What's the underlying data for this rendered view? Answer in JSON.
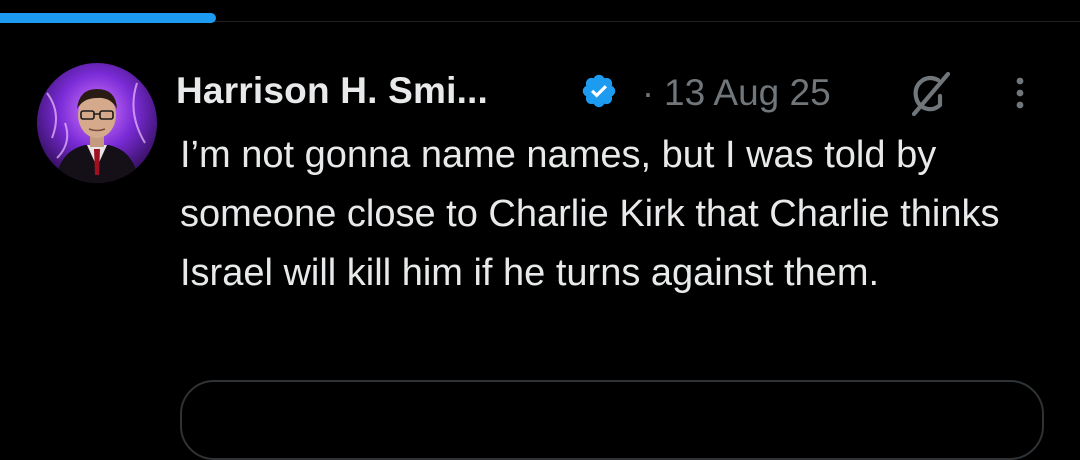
{
  "colors": {
    "background": "#000000",
    "accent": "#1d9bf0",
    "primary_text": "#e7e9ea",
    "secondary_text": "#71767b",
    "border": "#2f3336"
  },
  "loading_progress": 0.2,
  "tweet": {
    "author": {
      "display_name": "Harrison H. Smi...",
      "verified": true,
      "avatar_icon": "avatar-portrait"
    },
    "separator": "·",
    "timestamp": "13 Aug 25",
    "grok_icon": "grok-icon",
    "more_icon": "more-vertical-icon",
    "text": "I’m not gonna name names, but I was told by someone close to Charlie Kirk that Charlie thinks Israel will kill him if he turns against them."
  }
}
